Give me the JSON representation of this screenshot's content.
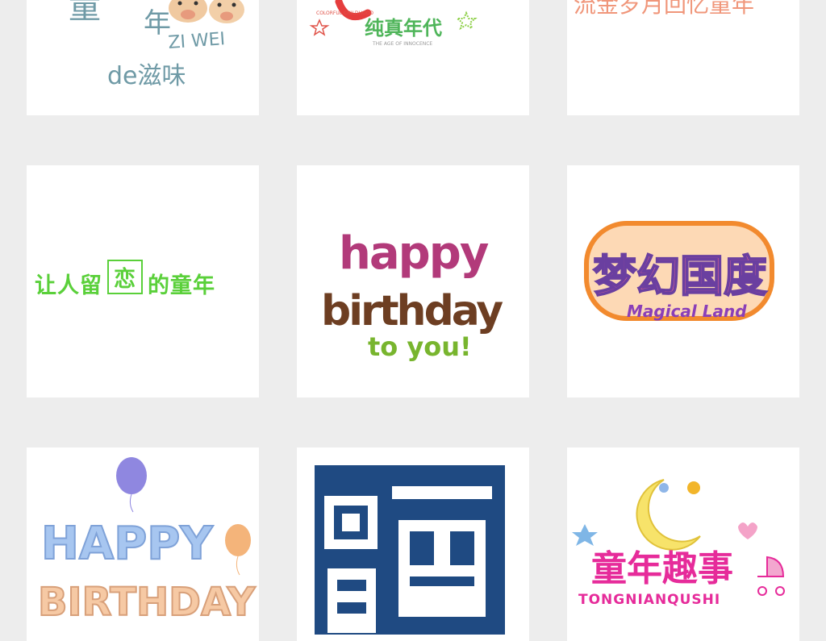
{
  "tiles": [
    {
      "name": "childhood-zi-wei-art",
      "lines": [
        "童",
        "年",
        "ZI WEI",
        "de滋味"
      ]
    },
    {
      "name": "innocence-era-art",
      "top": "COLORFUL CHILDHOOD",
      "middle": "纯真年代",
      "bottom": "THE AGE OF INNOCENCE"
    },
    {
      "name": "pink-childhood-art",
      "text": "流金岁月回忆童年"
    },
    {
      "name": "linger-childhood-art",
      "before": "让人留",
      "boxed": "恋",
      "after": "的童年"
    },
    {
      "name": "happy-birthday-colorful-art",
      "line1": "happy",
      "line2": "birthday",
      "line3": "to you!"
    },
    {
      "name": "magical-land-art",
      "chinese": "梦幻国度",
      "english": "Magical Land"
    },
    {
      "name": "happy-birthday-balloon-art",
      "line1": "HAPPY",
      "line2": "BIRTHDAY"
    },
    {
      "name": "look-back-seal-art",
      "chars": [
        "回",
        "首",
        "再"
      ]
    },
    {
      "name": "childhood-fun-art",
      "chinese": "童年趣事",
      "pinyin": "TONGNIANQUSHI"
    }
  ],
  "colors": {
    "background": "#ededed",
    "card": "#ffffff",
    "slate": "#6f9aa6",
    "green": "#5ad03a",
    "navy": "#1f4a82",
    "pink": "#e62b9a"
  }
}
